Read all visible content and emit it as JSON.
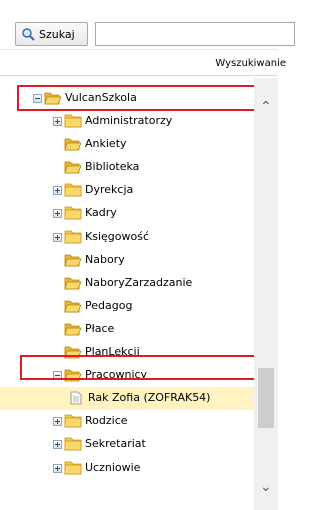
{
  "toolbar": {
    "search_label": "Szukaj",
    "search_value": "",
    "column_header": "Wyszukiwanie"
  },
  "tree": {
    "root": {
      "label": "VulcanSzkola",
      "expanded": true
    },
    "children": [
      {
        "label": "Administratorzy",
        "expandable": true
      },
      {
        "label": "Ankiety",
        "expandable": false
      },
      {
        "label": "Biblioteka",
        "expandable": false
      },
      {
        "label": "Dyrekcja",
        "expandable": true
      },
      {
        "label": "Kadry",
        "expandable": true
      },
      {
        "label": "Księgowość",
        "expandable": true
      },
      {
        "label": "Nabory",
        "expandable": false
      },
      {
        "label": "NaboryZarzadzanie",
        "expandable": false
      },
      {
        "label": "Pedagog",
        "expandable": false
      },
      {
        "label": "Płace",
        "expandable": false
      },
      {
        "label": "PlanLekcji",
        "expandable": false
      },
      {
        "label": "Pracownicy",
        "expandable": true,
        "expanded": true
      },
      {
        "label": "Rak Zofia (ZOFRAK54)",
        "selected": true
      },
      {
        "label": "Rodzice",
        "expandable": true
      },
      {
        "label": "Sekretariat",
        "expandable": true
      },
      {
        "label": "Uczniowie",
        "expandable": true
      }
    ]
  },
  "colors": {
    "highlight": "#e01b24",
    "selected_row": "#fff3c2",
    "folder": "#f5c842"
  },
  "icons": [
    "search-icon",
    "folder-icon",
    "open-folder-icon",
    "document-icon",
    "expand-plus-icon",
    "collapse-minus-icon",
    "scroll-up-icon",
    "scroll-down-icon"
  ]
}
